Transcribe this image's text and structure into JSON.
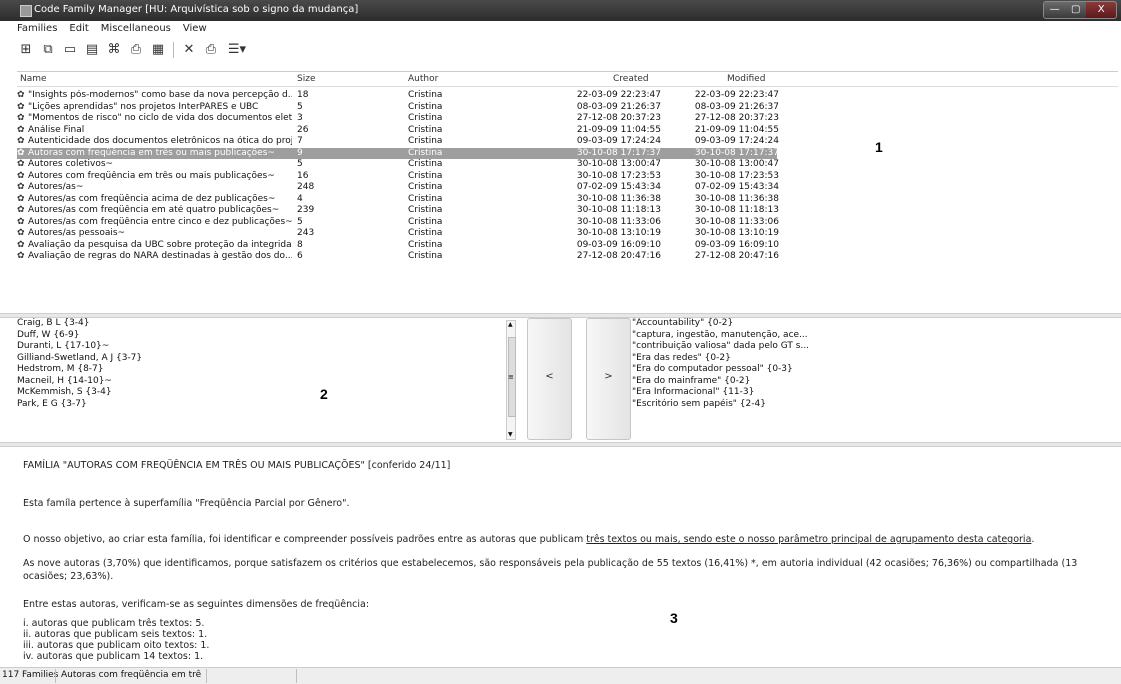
{
  "window": {
    "title": "Code Family Manager [HU: Arquivística sob o signo da mudança]",
    "buttons": [
      "—",
      "▢",
      "X"
    ]
  },
  "menu": [
    "Families",
    "Edit",
    "Miscellaneous",
    "View"
  ],
  "toolbar": [
    {
      "icon": "new-family-icon",
      "glyph": "⊞"
    },
    {
      "icon": "copy-family-icon",
      "glyph": "⧉"
    },
    {
      "icon": "window-icon",
      "glyph": "▭"
    },
    {
      "icon": "document-icon",
      "glyph": "▤"
    },
    {
      "icon": "network-icon",
      "glyph": "⌘"
    },
    {
      "icon": "output-icon",
      "glyph": "⎙"
    },
    {
      "icon": "report-icon",
      "glyph": "▦"
    },
    {
      "icon": "delete-icon",
      "glyph": "✕"
    },
    {
      "icon": "print-icon",
      "glyph": "⎙"
    },
    {
      "icon": "list-options-icon",
      "glyph": "☰▾"
    }
  ],
  "table": {
    "columns": [
      "Name",
      "Size",
      "Author",
      "Created",
      "Modified"
    ],
    "rows": [
      {
        "name": "\"Insights pós-modernos\" como base da nova percepção d...",
        "size": "18",
        "author": "Cristina",
        "created": "22-03-09 22:23:47",
        "modified": "22-03-09 22:23:47"
      },
      {
        "name": "\"Lições aprendidas\" nos projetos InterPARES e UBC",
        "size": "5",
        "author": "Cristina",
        "created": "08-03-09 21:26:37",
        "modified": "08-03-09 21:26:37"
      },
      {
        "name": "\"Momentos de risco\" no ciclo de vida dos documentos eletr...",
        "size": "3",
        "author": "Cristina",
        "created": "27-12-08 20:37:23",
        "modified": "27-12-08 20:37:23"
      },
      {
        "name": "Análise Final",
        "size": "26",
        "author": "Cristina",
        "created": "21-09-09 11:04:55",
        "modified": "21-09-09 11:04:55"
      },
      {
        "name": "Autenticidade dos documentos eletrônicos na ótica do proj...",
        "size": "7",
        "author": "Cristina",
        "created": "09-03-09 17:24:24",
        "modified": "09-03-09 17:24:24"
      },
      {
        "name": "Autoras com freqüência em três ou mais publicações~",
        "size": "9",
        "author": "Cristina",
        "created": "30-10-08 17:17:37",
        "modified": "30-10-08 17:17:37",
        "selected": true
      },
      {
        "name": "Autores coletivos~",
        "size": "5",
        "author": "Cristina",
        "created": "30-10-08 13:00:47",
        "modified": "30-10-08 13:00:47"
      },
      {
        "name": "Autores com freqüência em três ou mais publicações~",
        "size": "16",
        "author": "Cristina",
        "created": "30-10-08 17:23:53",
        "modified": "30-10-08 17:23:53"
      },
      {
        "name": "Autores/as~",
        "size": "248",
        "author": "Cristina",
        "created": "07-02-09 15:43:34",
        "modified": "07-02-09 15:43:34"
      },
      {
        "name": "Autores/as com freqüência acima de dez publicações~",
        "size": "4",
        "author": "Cristina",
        "created": "30-10-08 11:36:38",
        "modified": "30-10-08 11:36:38"
      },
      {
        "name": "Autores/as com freqüência em até quatro publicações~",
        "size": "239",
        "author": "Cristina",
        "created": "30-10-08 11:18:13",
        "modified": "30-10-08 11:18:13"
      },
      {
        "name": "Autores/as com freqüência entre cinco e dez publicações~",
        "size": "5",
        "author": "Cristina",
        "created": "30-10-08 11:33:06",
        "modified": "30-10-08 11:33:06"
      },
      {
        "name": "Autores/as pessoais~",
        "size": "243",
        "author": "Cristina",
        "created": "30-10-08 13:10:19",
        "modified": "30-10-08 13:10:19"
      },
      {
        "name": "Avaliação da pesquisa da UBC sobre proteção da integrida...",
        "size": "8",
        "author": "Cristina",
        "created": "09-03-09 16:09:10",
        "modified": "09-03-09 16:09:10"
      },
      {
        "name": "Avaliação de regras do NARA destinadas à gestão dos do...",
        "size": "6",
        "author": "Cristina",
        "created": "27-12-08 20:47:16",
        "modified": "27-12-08 20:47:16"
      }
    ]
  },
  "markers": {
    "m1": "1",
    "m2": "2",
    "m3": "3"
  },
  "codes_left": [
    "Craig, B L {3-4}",
    "Duff, W {6-9}",
    "Duranti, L {17-10}~",
    "Gilliand-Swetland, A J {3-7}",
    "Hedstrom, M {8-7}",
    "Macneil, H {14-10}~",
    "McKemmish, S {3-4}",
    "Park, E G {3-7}"
  ],
  "arrows": {
    "left": "<",
    "right": ">"
  },
  "codes_right": [
    "\"Accountability\" {0-2}",
    "\"captura, ingestão, manutenção, ace...",
    "\"contribuição valiosa\" dada pelo GT s...",
    "\"Era das redes\" {0-2}",
    "\"Era do computador pessoal\" {0-3}",
    "\"Era do mainframe\" {0-2}",
    "\"Era Informacional\" {11-3}",
    "\"Escritório sem papéis\" {2-4}"
  ],
  "comment": {
    "heading": "FAMÍLIA \"AUTORAS COM FREQÜÊNCIA EM TRÊS OU MAIS PUBLICAÇÕES\" [conferido 24/11]",
    "p1": "Esta famíla pertence à superfamília \"Freqüência Parcial por Gênero\".",
    "p2_a": "O nosso objetivo, ao criar esta família, foi identificar e compreender possíveis padrões entre as autoras que publicam ",
    "p2_u": "três textos ou mais, sendo este o nosso parâmetro principal de agrupamento desta categoria",
    "p2_b": ".",
    "p3": "As nove autoras (3,70%) que identificamos, porque satisfazem os critérios que estabelecemos, são responsáveis pela publicação de 55 textos (16,41%) *, em autoria individual (42 ocasiões; 76,36%) ou compartilhada (13 ocasiões; 23,63%).",
    "p4": "Entre estas autoras, verificam-se as seguintes dimensões de freqüência:",
    "l1": "i. autoras que publicam três textos: 5.",
    "l2": "ii. autoras que publicam seis textos: 1.",
    "l3": "iii. autoras que publicam oito textos: 1.",
    "l4": "iv. autoras que publicam 14 textos: 1."
  },
  "status": {
    "count": "117 Families",
    "current": "Autoras com freqüência em três d"
  }
}
